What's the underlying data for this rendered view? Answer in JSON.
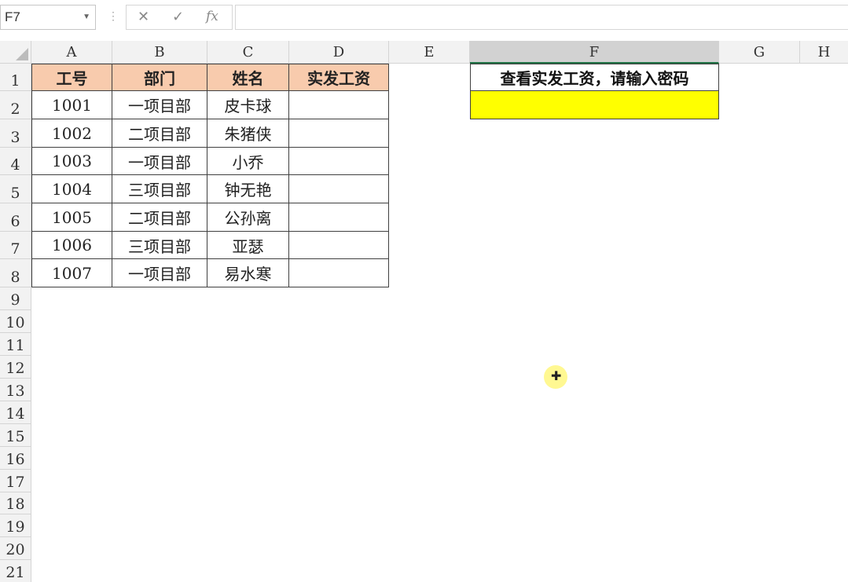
{
  "formula_bar": {
    "name_box": "F7",
    "cancel_icon": "✕",
    "enter_icon": "✓",
    "fx_label": "fx",
    "formula_value": ""
  },
  "columns": [
    "A",
    "B",
    "C",
    "D",
    "E",
    "F",
    "G",
    "H"
  ],
  "rows": [
    "1",
    "2",
    "3",
    "4",
    "5",
    "6",
    "7",
    "8",
    "9",
    "10",
    "11",
    "12",
    "13",
    "14",
    "15",
    "16",
    "17",
    "18",
    "19",
    "20",
    "21"
  ],
  "table": {
    "headers": [
      "工号",
      "部门",
      "姓名",
      "实发工资"
    ],
    "rows": [
      [
        "1001",
        "一项目部",
        "皮卡球",
        ""
      ],
      [
        "1002",
        "二项目部",
        "朱猪侠",
        ""
      ],
      [
        "1003",
        "一项目部",
        "小乔",
        ""
      ],
      [
        "1004",
        "三项目部",
        "钟无艳",
        ""
      ],
      [
        "1005",
        "二项目部",
        "公孙离",
        ""
      ],
      [
        "1006",
        "三项目部",
        "亚瑟",
        ""
      ],
      [
        "1007",
        "一项目部",
        "易水寒",
        ""
      ]
    ]
  },
  "password_box": {
    "prompt": "查看实发工资，请输入密码",
    "value": ""
  },
  "colors": {
    "header_fill": "#f8cbad",
    "password_fill": "#ffff00",
    "active_header": "#d2d2d2"
  }
}
